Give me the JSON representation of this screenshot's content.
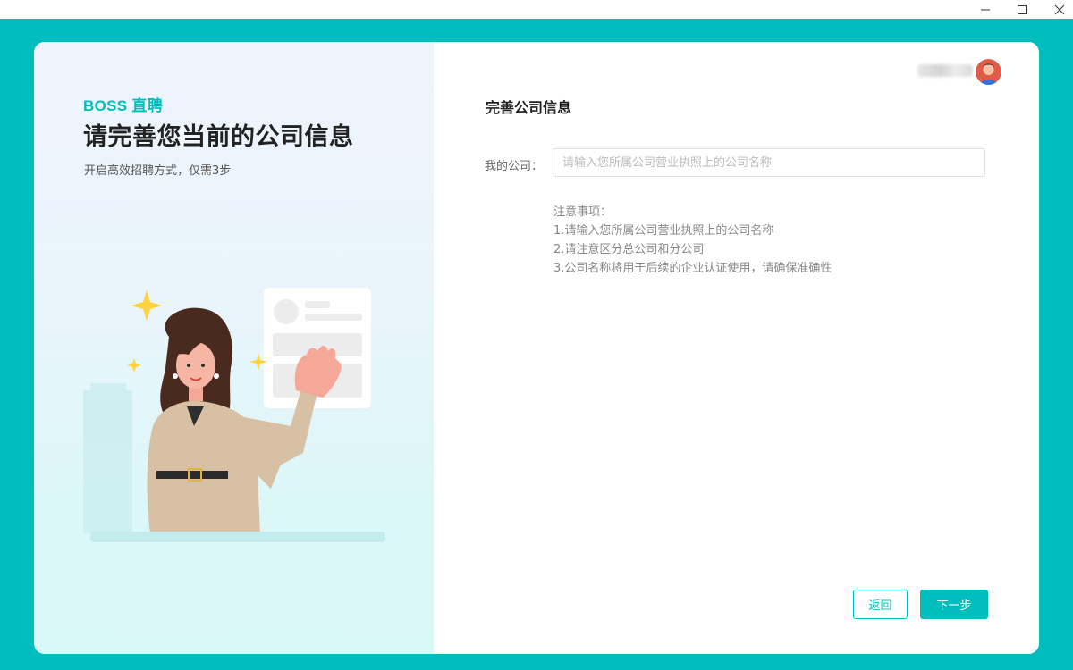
{
  "window": {
    "minimize_icon": "minimize-icon",
    "maximize_icon": "maximize-icon",
    "close_icon": "close-icon"
  },
  "left_panel": {
    "brand": "BOSS 直聘",
    "headline": "请完善您当前的公司信息",
    "subtitle": "开启高效招聘方式，仅需3步",
    "illustration": "woman-waving-illustration"
  },
  "header": {
    "avatar_icon": "user-avatar-icon"
  },
  "form": {
    "title": "完善公司信息",
    "company_label": "我的公司：",
    "company_value": "",
    "company_placeholder": "请输入您所属公司营业执照上的公司名称",
    "notes_title": "注意事项：",
    "notes": [
      "1.请输入您所属公司营业执照上的公司名称",
      "2.请注意区分总公司和分公司",
      "3.公司名称将用于后续的企业认证使用，请确保准确性"
    ],
    "back_label": "返回",
    "next_label": "下一步"
  },
  "colors": {
    "brand": "#00bebd",
    "background": "#00bebd"
  }
}
